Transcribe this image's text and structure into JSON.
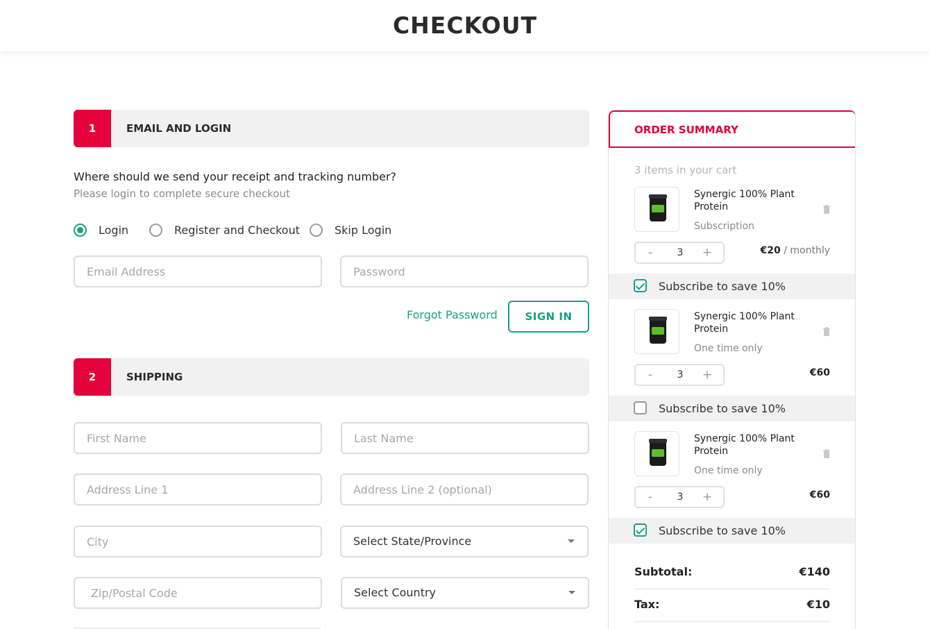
{
  "header": {
    "title": "CHECKOUT"
  },
  "step1": {
    "number": "1",
    "title": "EMAIL AND LOGIN",
    "question": "Where should we send your receipt and tracking number?",
    "subtext": "Please login to complete secure checkout",
    "options": [
      {
        "label": "Login",
        "checked": true
      },
      {
        "label": "Register and Checkout",
        "checked": false
      },
      {
        "label": "Skip Login",
        "checked": false
      }
    ],
    "email_placeholder": "Email Address",
    "password_placeholder": "Password",
    "forgot_label": "Forgot Password",
    "signin_label": "SIGN IN"
  },
  "step2": {
    "number": "2",
    "title": "SHIPPING",
    "first_name_placeholder": "First Name",
    "last_name_placeholder": "Last Name",
    "address1_placeholder": "Address Line 1",
    "address2_placeholder": "Address Line 2 (optional)",
    "city_placeholder": "City",
    "state_select": "Select State/Province",
    "zip_placeholder": "Zip/Postal Code",
    "country_select": "Select Country"
  },
  "summary": {
    "title": "ORDER SUMMARY",
    "items_count": "3 items in your cart",
    "items": [
      {
        "name": "Synergic 100% Plant Protein",
        "type": "Subscription",
        "qty": "3",
        "price": "€20",
        "price_suffix": " / monthly",
        "subscribe_label": "Subscribe to save 10%",
        "subscribed": true
      },
      {
        "name": "Synergic 100% Plant Protein",
        "type": "One time only",
        "qty": "3",
        "price": "€60",
        "price_suffix": "",
        "subscribe_label": "Subscribe to save 10%",
        "subscribed": false
      },
      {
        "name": "Synergic 100% Plant Protein",
        "type": "One time only",
        "qty": "3",
        "price": "€60",
        "price_suffix": "",
        "subscribe_label": "Subscribe to save 10%",
        "subscribed": true
      }
    ],
    "stepper_minus": "-",
    "stepper_plus": "+",
    "subtotal_label": "Subtotal:",
    "subtotal_value": "€140",
    "tax_label": "Tax:",
    "tax_value": "€10"
  },
  "colors": {
    "accent_red": "#e4003a",
    "accent_green": "#18a087"
  }
}
